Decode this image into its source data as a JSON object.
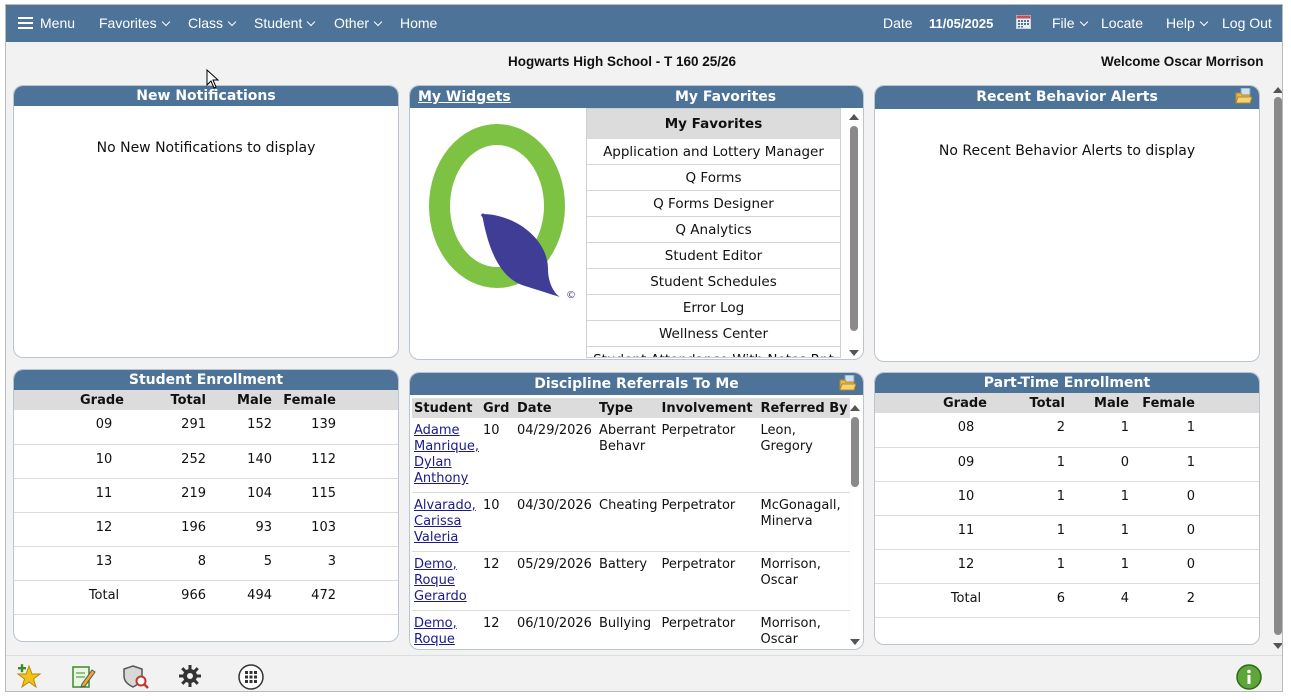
{
  "topbar": {
    "menu_label": "Menu",
    "nav": [
      "Favorites",
      "Class",
      "Student",
      "Other"
    ],
    "home": "Home",
    "date_label": "Date",
    "date_value": "11/05/2025",
    "file": "File",
    "locate": "Locate",
    "help": "Help",
    "logout": "Log Out"
  },
  "subbar": {
    "school": "Hogwarts High School - T 160 25/26",
    "welcome": "Welcome Oscar Morrison"
  },
  "notifications": {
    "title": "New Notifications",
    "empty": "No New Notifications to display"
  },
  "widgets": {
    "link": "My Widgets",
    "title": "My Favorites",
    "copyright": "©",
    "list_header": "My Favorites",
    "items": [
      "Application and Lottery Manager",
      "Q Forms",
      "Q Forms Designer",
      "Q Analytics",
      "Student Editor",
      "Student Schedules",
      "Error Log",
      "Wellness Center",
      "Student Attendance With Notes Rpt"
    ]
  },
  "behavior": {
    "title": "Recent Behavior Alerts",
    "empty": "No Recent Behavior Alerts to display"
  },
  "enrollment": {
    "title": "Student Enrollment",
    "columns": [
      "Grade",
      "Total",
      "Male",
      "Female"
    ],
    "rows": [
      [
        "09",
        "291",
        "152",
        "139"
      ],
      [
        "10",
        "252",
        "140",
        "112"
      ],
      [
        "11",
        "219",
        "104",
        "115"
      ],
      [
        "12",
        "196",
        "93",
        "103"
      ],
      [
        "13",
        "8",
        "5",
        "3"
      ],
      [
        "Total",
        "966",
        "494",
        "472"
      ]
    ]
  },
  "discipline": {
    "title": "Discipline Referrals To Me",
    "columns": [
      "Student",
      "Grd",
      "Date",
      "Type",
      "Involvement",
      "Referred By"
    ],
    "rows": [
      [
        "Adame Manrique, Dylan Anthony",
        "10",
        "04/29/2026",
        "Aberrant Behavr",
        "Perpetrator",
        "Leon, Gregory"
      ],
      [
        "Alvarado, Carissa Valeria",
        "10",
        "04/30/2026",
        "Cheating",
        "Perpetrator",
        "McGonagall, Minerva"
      ],
      [
        "Demo, Roque Gerardo",
        "12",
        "05/29/2026",
        "Battery",
        "Perpetrator",
        "Morrison, Oscar"
      ],
      [
        "Demo, Roque",
        "12",
        "06/10/2026",
        "Bullying",
        "Perpetrator",
        "Morrison, Oscar"
      ]
    ]
  },
  "parttime": {
    "title": "Part-Time Enrollment",
    "columns": [
      "Grade",
      "Total",
      "Male",
      "Female"
    ],
    "rows": [
      [
        "08",
        "2",
        "1",
        "1"
      ],
      [
        "09",
        "1",
        "0",
        "1"
      ],
      [
        "10",
        "1",
        "1",
        "0"
      ],
      [
        "11",
        "1",
        "1",
        "0"
      ],
      [
        "12",
        "1",
        "1",
        "0"
      ],
      [
        "Total",
        "6",
        "4",
        "2"
      ]
    ]
  },
  "bottombar": {
    "icons": [
      "star-add-icon",
      "notepad-edit-icon",
      "shield-search-icon",
      "gear-icon",
      "grid-apps-icon",
      "info-icon"
    ]
  },
  "colors": {
    "header_blue": "#4e7398",
    "table_header_gray": "#dcdcdc",
    "q_logo_green": "#7dc243",
    "q_logo_leaf": "#3f3d96"
  }
}
